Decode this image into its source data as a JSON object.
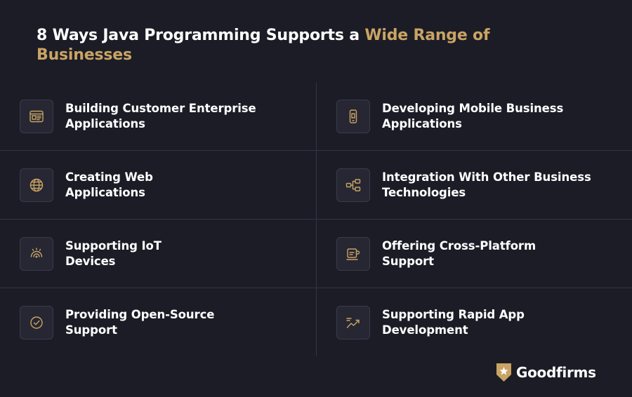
{
  "title": {
    "part1": "8 Ways Java Programming Supports a ",
    "accent": "Wide Range of Businesses"
  },
  "colors": {
    "background": "#1b1c26",
    "accent": "#c9a463",
    "text": "#ffffff",
    "divider": "#343544",
    "icon_box": "#262733"
  },
  "items": [
    {
      "label": "Building Customer Enterprise\nApplications",
      "icon": "browser-window-icon"
    },
    {
      "label": "Developing Mobile Business\nApplications",
      "icon": "mobile-phone-icon"
    },
    {
      "label": "Creating Web\nApplications",
      "icon": "globe-icon"
    },
    {
      "label": "Integration With Other Business\nTechnologies",
      "icon": "network-nodes-icon"
    },
    {
      "label": "Supporting IoT\nDevices",
      "icon": "wifi-signal-icon"
    },
    {
      "label": "Offering Cross-Platform\nSupport",
      "icon": "coffee-cup-icon"
    },
    {
      "label": "Providing Open-Source\nSupport",
      "icon": "check-circle-icon"
    },
    {
      "label": "Supporting Rapid App\nDevelopment",
      "icon": "trending-up-icon"
    }
  ],
  "brand": {
    "name": "Goodfirms",
    "icon": "star-shield-icon"
  }
}
